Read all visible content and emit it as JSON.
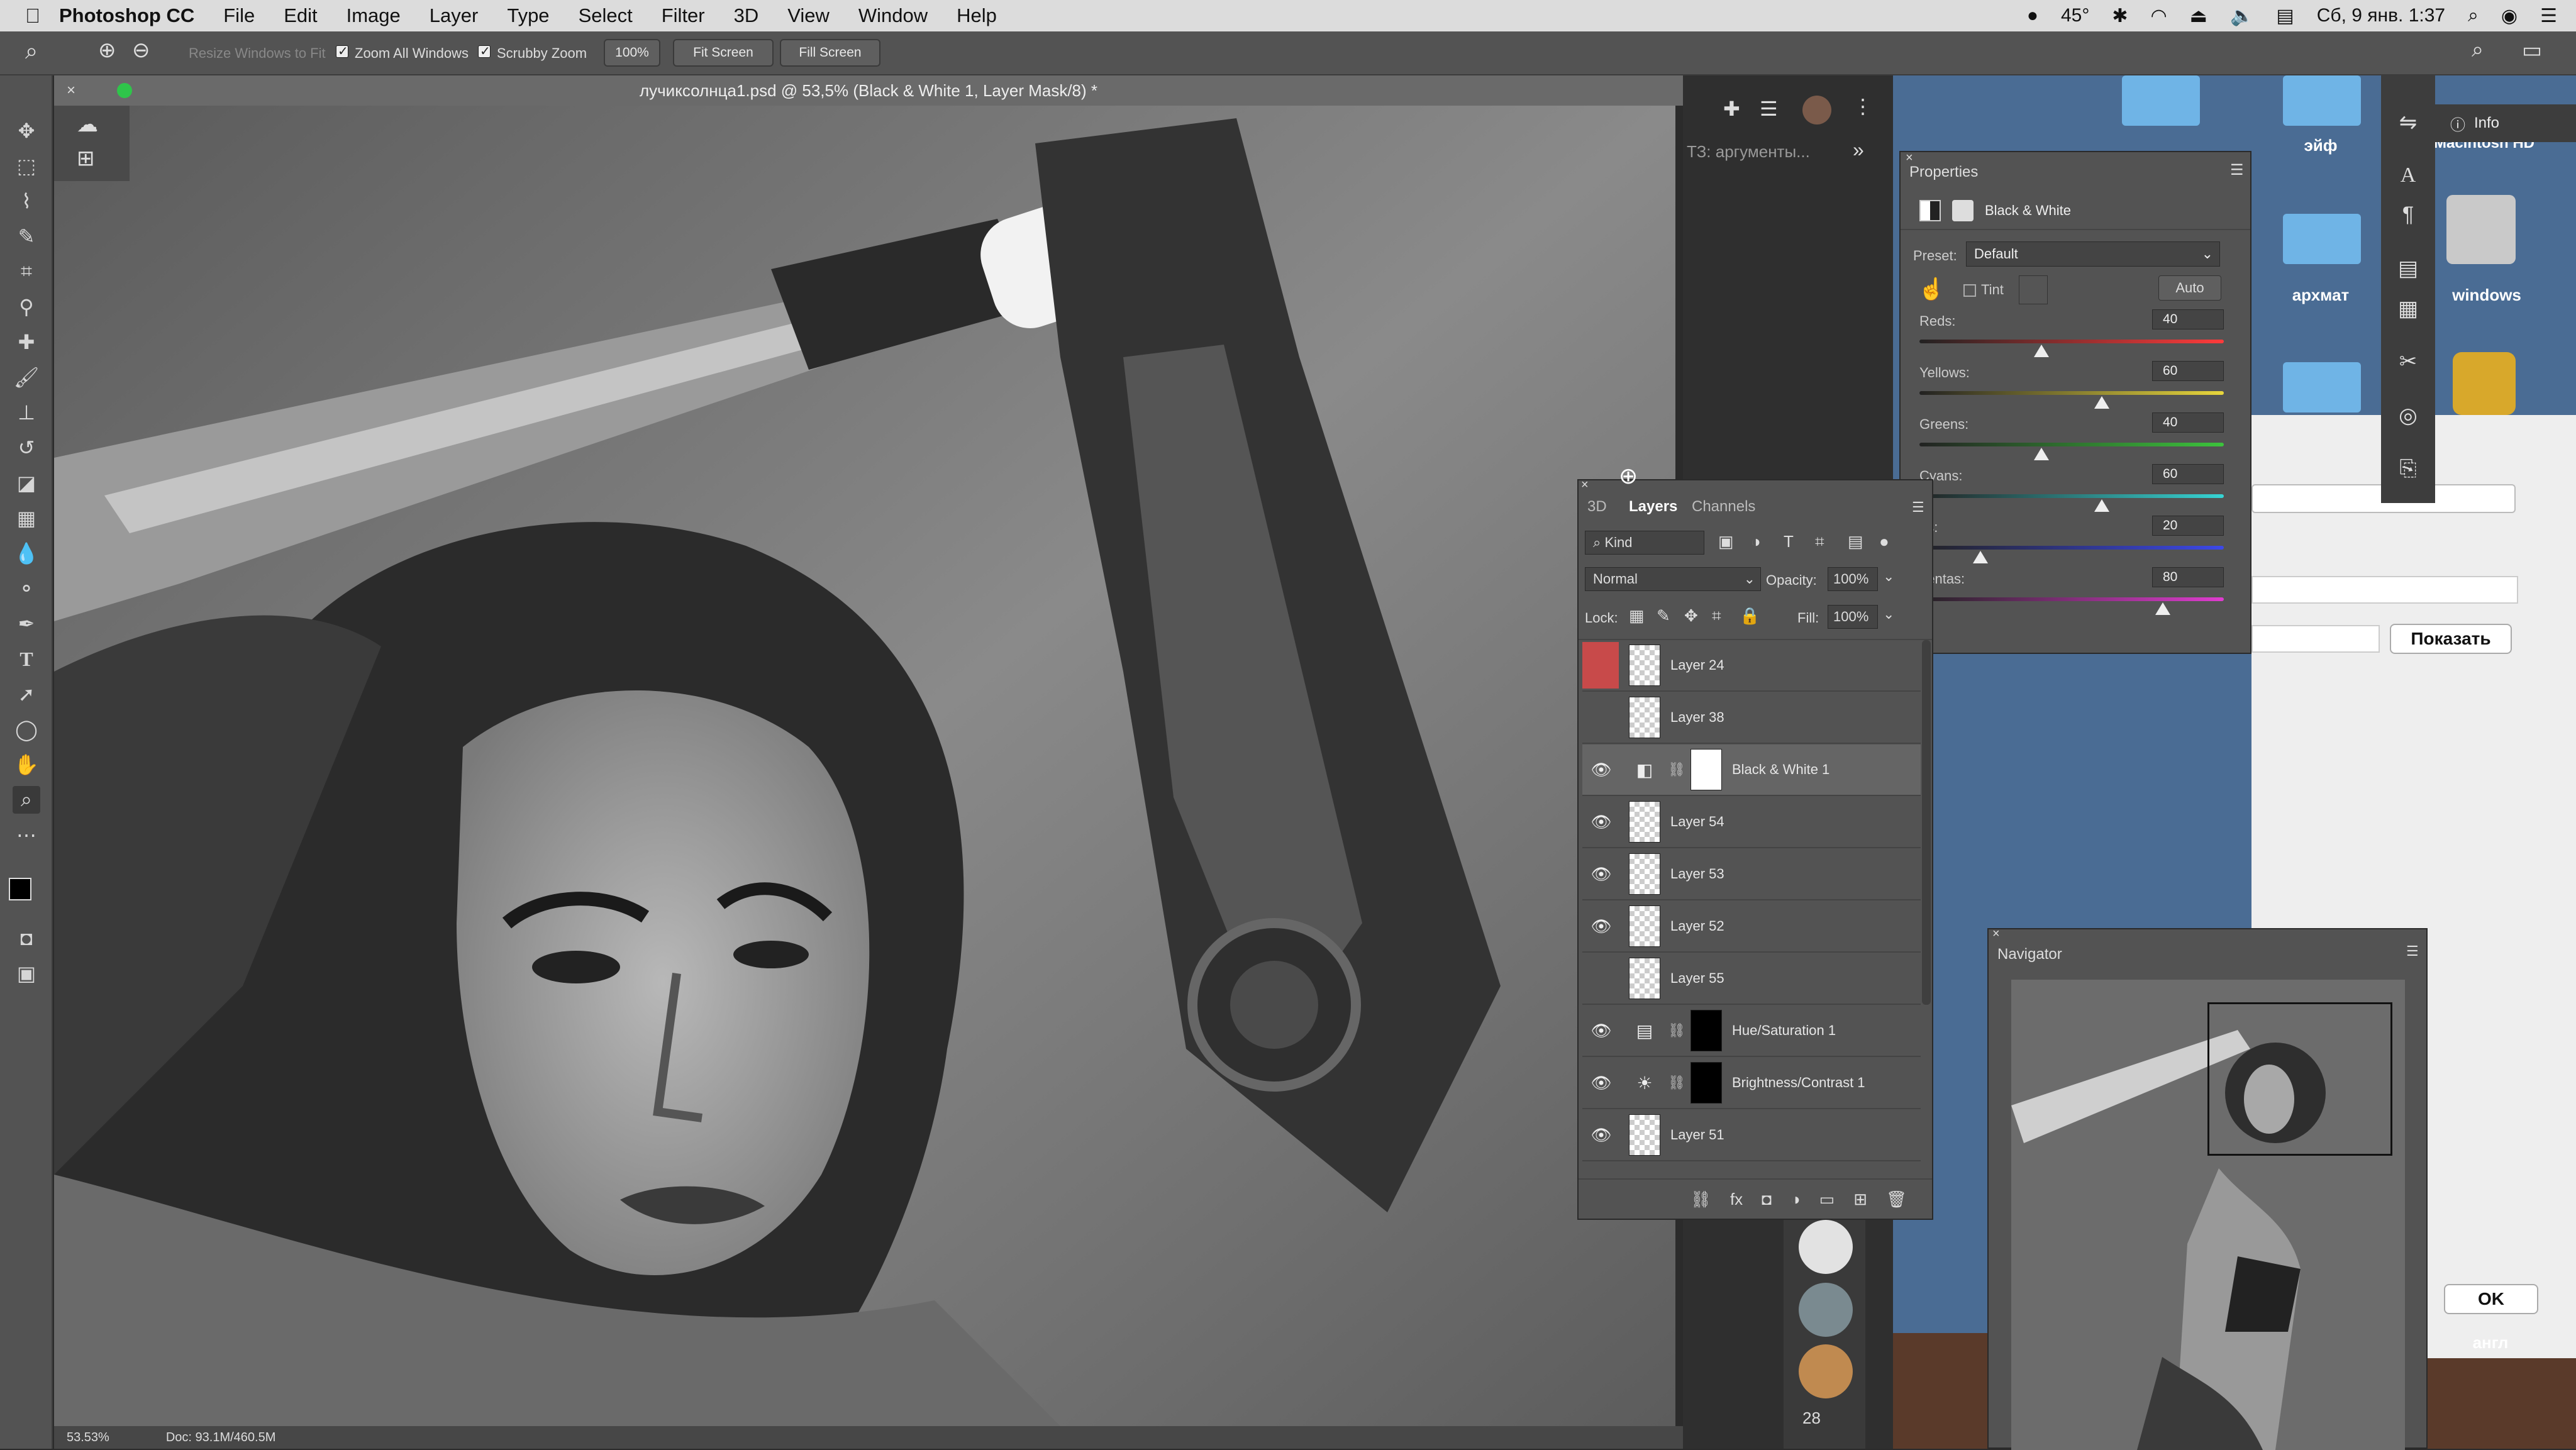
{
  "menubar": {
    "app_name": "Photoshop CC",
    "items": [
      "File",
      "Edit",
      "Image",
      "Layer",
      "Type",
      "Select",
      "Filter",
      "3D",
      "View",
      "Window",
      "Help"
    ],
    "temperature": "45°",
    "datetime": "Сб, 9 янв. 1:37"
  },
  "options": {
    "resize_windows": "Resize Windows to Fit",
    "zoom_all": "Zoom All Windows",
    "scrubby": "Scrubby Zoom",
    "zoom_100": "100%",
    "fit_screen": "Fit Screen",
    "fill_screen": "Fill Screen"
  },
  "document": {
    "title": "лучиксолнца1.psd @ 53,5% (Black & White 1, Layer Mask/8) *",
    "zoom": "53.53%",
    "doc_size": "Doc: 93.1M/460.5M"
  },
  "right_panel": {
    "search_text": "ТЗ: аргументы..."
  },
  "layers_panel": {
    "tabs": [
      "3D",
      "Layers",
      "Channels"
    ],
    "filter_kind": "Kind",
    "blend_mode": "Normal",
    "opacity_label": "Opacity:",
    "opacity": "100%",
    "lock_label": "Lock:",
    "fill_label": "Fill:",
    "fill": "100%",
    "layers": [
      {
        "name": "Layer 24",
        "visible": false,
        "type": "pixel"
      },
      {
        "name": "Layer 38",
        "visible": false,
        "type": "pixel"
      },
      {
        "name": "Black & White 1",
        "visible": true,
        "type": "adjustment",
        "selected": true
      },
      {
        "name": "Layer 54",
        "visible": true,
        "type": "pixel"
      },
      {
        "name": "Layer 53",
        "visible": true,
        "type": "pixel"
      },
      {
        "name": "Layer 52",
        "visible": true,
        "type": "pixel"
      },
      {
        "name": "Layer 55",
        "visible": false,
        "type": "pixel"
      },
      {
        "name": "Hue/Saturation 1",
        "visible": true,
        "type": "adjustment"
      },
      {
        "name": "Brightness/Contrast 1",
        "visible": true,
        "type": "adjustment"
      },
      {
        "name": "Layer 51",
        "visible": true,
        "type": "pixel"
      }
    ]
  },
  "properties": {
    "title": "Properties",
    "adjustment": "Black & White",
    "preset_label": "Preset:",
    "preset": "Default",
    "tint_label": "Tint",
    "auto_label": "Auto",
    "sliders": [
      {
        "label": "Reds:",
        "value": "40",
        "fraction": 0.4,
        "color_from": "#ff3b3b",
        "color_to": "#ff3b3b"
      },
      {
        "label": "Yellows:",
        "value": "60",
        "fraction": 0.6,
        "color_from": "#e8d63c",
        "color_to": "#e8d63c"
      },
      {
        "label": "Greens:",
        "value": "40",
        "fraction": 0.4,
        "color_from": "#3cc43c",
        "color_to": "#3cc43c"
      },
      {
        "label": "Cyans:",
        "value": "60",
        "fraction": 0.6,
        "color_from": "#36d4d4",
        "color_to": "#36d4d4"
      },
      {
        "label": "es:",
        "value": "20",
        "fraction": 0.2,
        "color_from": "#3c48e8",
        "color_to": "#3c48e8"
      },
      {
        "label": "gentas:",
        "value": "80",
        "fraction": 0.8,
        "color_from": "#e03cd0",
        "color_to": "#e03cd0"
      }
    ]
  },
  "navigator": {
    "title": "Navigator"
  },
  "info_panel": {
    "label": "Info"
  },
  "desktop": {
    "labels": [
      "эйф",
      "архмат",
      "windows"
    ],
    "hd_label": "Macintosh HD",
    "dialog_show": "Показать",
    "dialog_ok": "OK",
    "dialog_bottom": "англ"
  },
  "dock": {
    "badge": "28"
  }
}
